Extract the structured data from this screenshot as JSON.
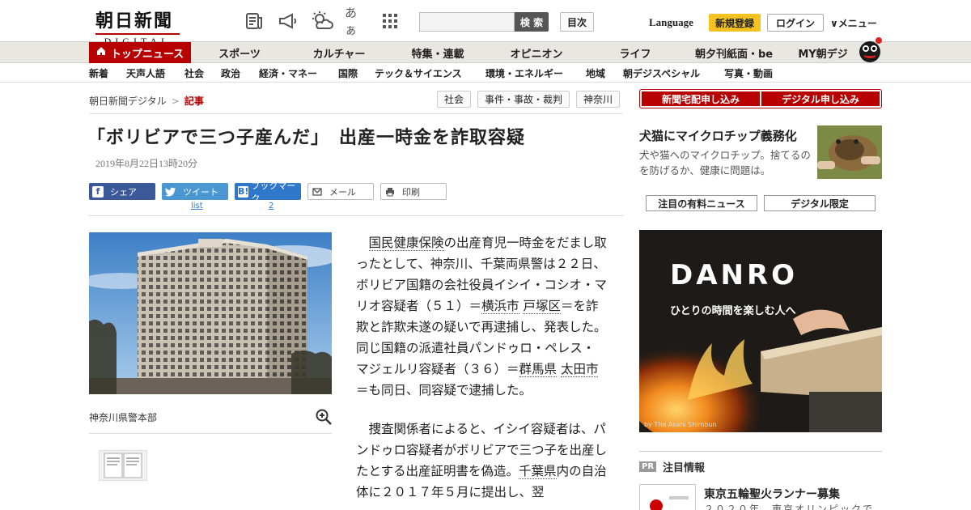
{
  "header": {
    "logo_main": "朝日新聞",
    "logo_sub": "DIGITAL",
    "icons": [
      "newspaper-icon",
      "megaphone-icon",
      "weather-icon",
      "font-size-icon",
      "apps-grid-icon"
    ],
    "font_glyph": "あぁ",
    "search_placeholder": "",
    "search_label": "検 索",
    "mokuji_label": "目次",
    "language_label": "Language",
    "signup_label": "新規登録",
    "login_label": "ログイン",
    "menu_label": "∨メニュー",
    "accent_color": "#b80000",
    "signup_color": "#f5c31f"
  },
  "nav_main": [
    "トップニュース",
    "スポーツ",
    "カルチャー",
    "特集・連載",
    "オピニオン",
    "ライフ",
    "朝夕刊紙面・be",
    "MY朝デジ"
  ],
  "nav_sub": [
    "新着",
    "天声人語",
    "社会",
    "政治",
    "経済・マネー",
    "国際",
    "テック＆サイエンス",
    "環境・エネルギー",
    "地域",
    "朝デジスペシャル",
    "写真・動画"
  ],
  "breadcrumb": {
    "home": "朝日新聞デジタル",
    "sep": ">",
    "current": "記事"
  },
  "tags": [
    "社会",
    "事件・事故・裁判",
    "神奈川"
  ],
  "article": {
    "title": "「ボリビアで三つ子産んだ」　出産一時金を詐取容疑",
    "date": "2019年8月22日13時20分",
    "photo_caption": "神奈川県警本部",
    "paragraphs": [
      [
        "",
        "国民健康保険",
        "の出産育児一時金をだまし取ったとして、神奈川、千葉両県警は２２日、ボリビア国籍の会社役員イシイ・コシオ・マリオ容疑者（５１）＝",
        "横浜市",
        " ",
        "戸塚区",
        "＝を詐欺と詐欺未遂の疑いで再逮捕し、発表した。同じ国籍の派遣社員パンドゥロ・ペレス・マジェルリ容疑者（３６）＝",
        "群馬県",
        " ",
        "太田市",
        "＝も同日、同容疑で逮捕した。"
      ],
      [
        "",
        "捜査関係者によると、イシイ容疑者は、パンドゥロ容疑者がボリビアで三つ子を出産したとする出産証明書を偽造。",
        "千葉県",
        "内の自治体に２０１７年５月に提出し、翌"
      ]
    ]
  },
  "share": {
    "facebook": "シェア",
    "twitter": "ツイート",
    "twitter_count": "list",
    "hatena": "ブックマーク",
    "hatena_count": "2",
    "mail": "メール",
    "print": "印刷"
  },
  "sidebar": {
    "register_paper": "新聞宅配申し込み",
    "register_digital": "デジタル申し込み",
    "feature_title": "犬猫にマイクロチップ義務化",
    "feature_text": "犬や猫へのマイクロチップ。捨てるのを防げるか、健康に問題は。",
    "tab_paid": "注目の有料ニュース",
    "tab_digital": "デジタル限定",
    "ad_logo": "DANRO",
    "ad_tagline": "ひとりの時間を楽しむ人へ",
    "ad_credit": "by The Asahi Shimbun",
    "pr_badge": "PR",
    "pr_label": "注目情報",
    "pr_title": "東京五輪聖火ランナー募集",
    "pr_text": "２０２０年、東京オリンピックで"
  }
}
